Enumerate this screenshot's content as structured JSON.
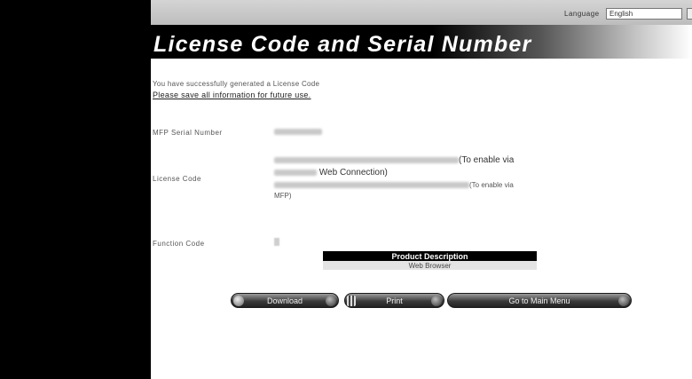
{
  "header": {
    "language_label": "Language",
    "language_value": "English"
  },
  "banner": {
    "title": "License Code and Serial Number"
  },
  "messages": {
    "success": "You have successfully generated a License Code",
    "save_notice": "Please save all information for future use."
  },
  "fields": {
    "serial_label": "MFP Serial Number",
    "license_label": "License Code",
    "license_note_1": "(To enable via",
    "license_note_1b": "Web Connection)",
    "license_note_2": "(To enable via",
    "license_note_2b": "MFP)",
    "function_label": "Function Code"
  },
  "product_table": {
    "header": "Product Description",
    "rows": [
      "Web Browser"
    ]
  },
  "buttons": {
    "download": "Download",
    "print": "Print",
    "main_menu": "Go to Main Menu"
  }
}
